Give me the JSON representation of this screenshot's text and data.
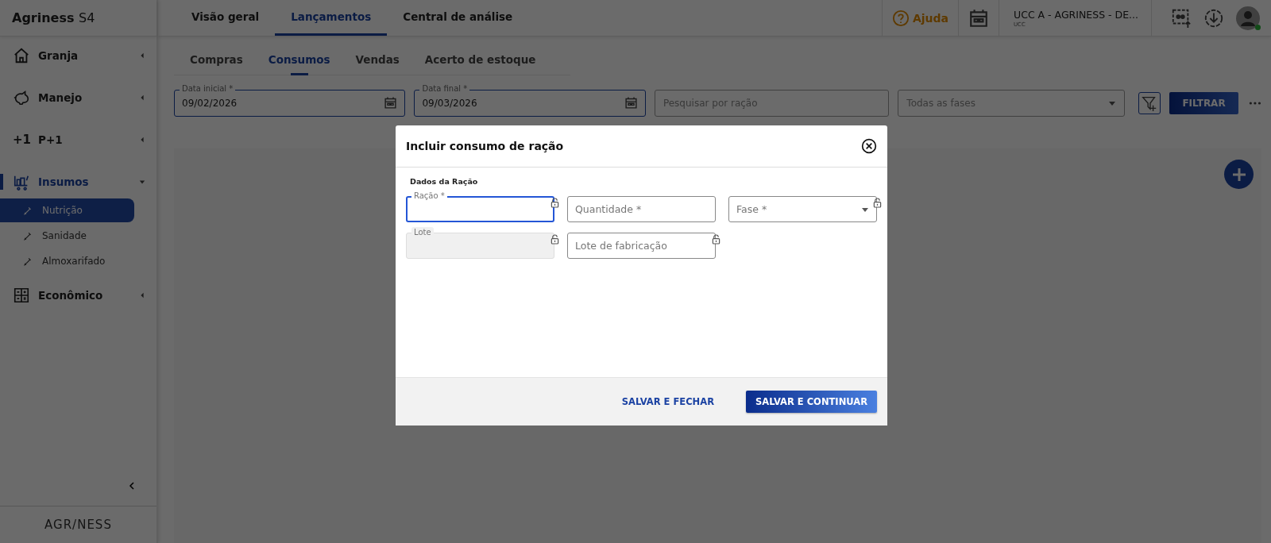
{
  "app": {
    "name": "Agriness",
    "edition": "S4"
  },
  "top_tabs": [
    {
      "label": "Visão geral",
      "selected": false
    },
    {
      "label": "Lançamentos",
      "selected": true
    },
    {
      "label": "Central de análise",
      "selected": false
    }
  ],
  "header": {
    "help": "Ajuda",
    "unit": "UCC A - AGRINESS - DE...",
    "unit_caption": "UCC",
    "online": true
  },
  "sidebar": {
    "items": [
      {
        "label": "Granja",
        "expanded": false,
        "selected": false
      },
      {
        "label": "Manejo",
        "expanded": false,
        "selected": false
      },
      {
        "label": "P+1",
        "icon_text": "+1",
        "expanded": false,
        "selected": false
      },
      {
        "label": "Insumos",
        "expanded": true,
        "selected": true,
        "children": [
          {
            "label": "Nutrição",
            "selected": true
          },
          {
            "label": "Sanidade",
            "selected": false
          },
          {
            "label": "Almoxarifado",
            "selected": false
          }
        ]
      },
      {
        "label": "Econômico",
        "expanded": false,
        "selected": false
      }
    ],
    "footer_logo": "AGR/NESS"
  },
  "sub_tabs": [
    {
      "label": "Compras",
      "selected": false
    },
    {
      "label": "Consumos",
      "selected": true
    },
    {
      "label": "Vendas",
      "selected": false
    },
    {
      "label": "Acerto de estoque",
      "selected": false
    }
  ],
  "filters": {
    "start_date": {
      "label": "Data inicial *",
      "value": "09/02/2026"
    },
    "end_date": {
      "label": "Data final *",
      "value": "09/03/2026"
    },
    "search": {
      "placeholder": "Pesquisar por ração"
    },
    "phase": {
      "placeholder": "Todas as fases"
    },
    "filter_button": "FILTRAR"
  },
  "dialog": {
    "title": "Incluir consumo de ração",
    "section": "Dados da Ração",
    "rows": [
      [
        {
          "kind": "text",
          "label": "Ração *",
          "focused": true,
          "disabled": false,
          "lock": true
        },
        {
          "kind": "text",
          "label": "Quantidade *",
          "focused": false,
          "disabled": false,
          "lock": false
        },
        {
          "kind": "select",
          "label": "Fase *",
          "focused": false,
          "disabled": false,
          "lock": true
        }
      ],
      [
        {
          "kind": "text",
          "label": "Lote",
          "focused": false,
          "disabled": true,
          "lock": true
        },
        {
          "kind": "text",
          "label": "Lote de fabricação",
          "focused": false,
          "disabled": false,
          "lock": true
        }
      ]
    ],
    "secondary_button": "SALVAR E FECHAR",
    "primary_button": "SALVAR E CONTINUAR"
  }
}
